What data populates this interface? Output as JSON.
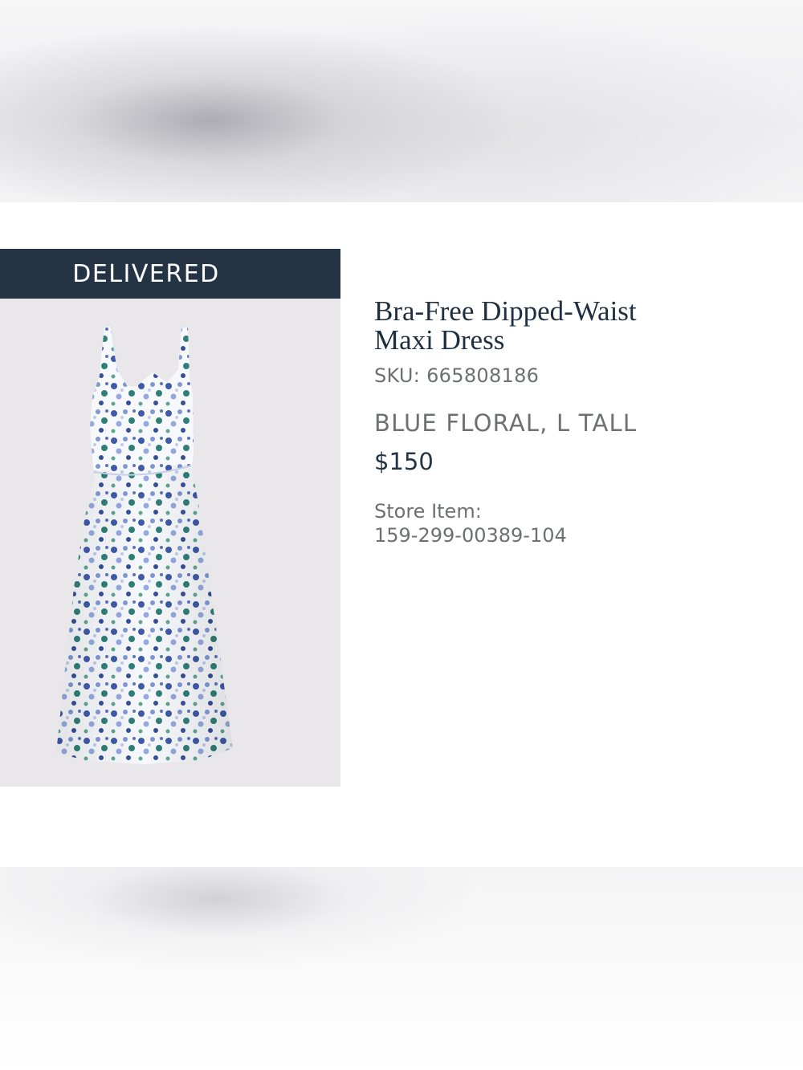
{
  "order_item": {
    "status": "DELIVERED",
    "product_name": "Bra-Free Dipped-Waist Maxi Dress",
    "sku": "SKU: 665808186",
    "variant": "BLUE FLORAL, L TALL",
    "price": "$150",
    "store_item_label": "Store Item:",
    "store_item_number": "159-299-00389-104",
    "image": {
      "description": "blue floral maxi dress product photo",
      "icon": "dress-image"
    }
  },
  "colors": {
    "status_bar": "#243444",
    "image_background": "#e9e7ea",
    "title_text": "#1f2f3f",
    "secondary_text": "#6d6f72"
  }
}
